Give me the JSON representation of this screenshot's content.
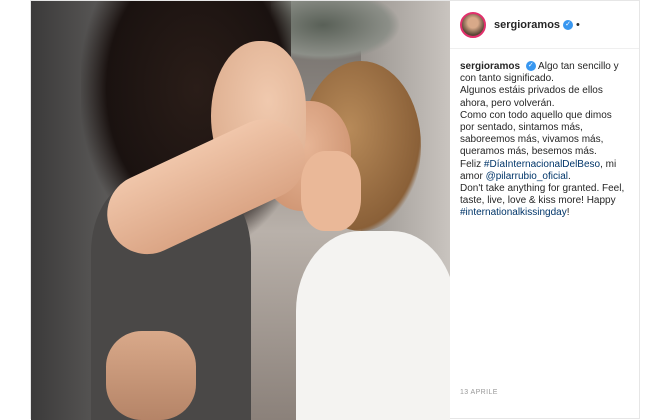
{
  "post": {
    "photo_alt_icon": "couple-kissing-photo",
    "username": "sergioramos",
    "verified_icon": "verified-badge-icon",
    "separator": "•",
    "caption": {
      "username": "sergioramos",
      "first_line_rest": "Algo tan sencillo y",
      "lines": [
        "con tanto significado.",
        "Algunos estáis privados de ellos",
        "ahora, pero volverán.",
        "Como con todo aquello que dimos",
        "por sentado, sintamos más,",
        "saboreemos más, vivamos más,",
        "queramos más, besemos más."
      ],
      "feliz": "Feliz ",
      "hashtag1": "#DíaInternacionalDelBeso",
      "mi": ", mi",
      "amor": "amor ",
      "mention": "@pilarrubio_oficial",
      "period": ".",
      "en_lines": [
        "Don't take anything for granted. Feel,",
        "taste, live, love & kiss more! Happy"
      ],
      "hashtag2": "#internationalkissingday",
      "exclaim": "!"
    },
    "date": "13 APRILE"
  }
}
